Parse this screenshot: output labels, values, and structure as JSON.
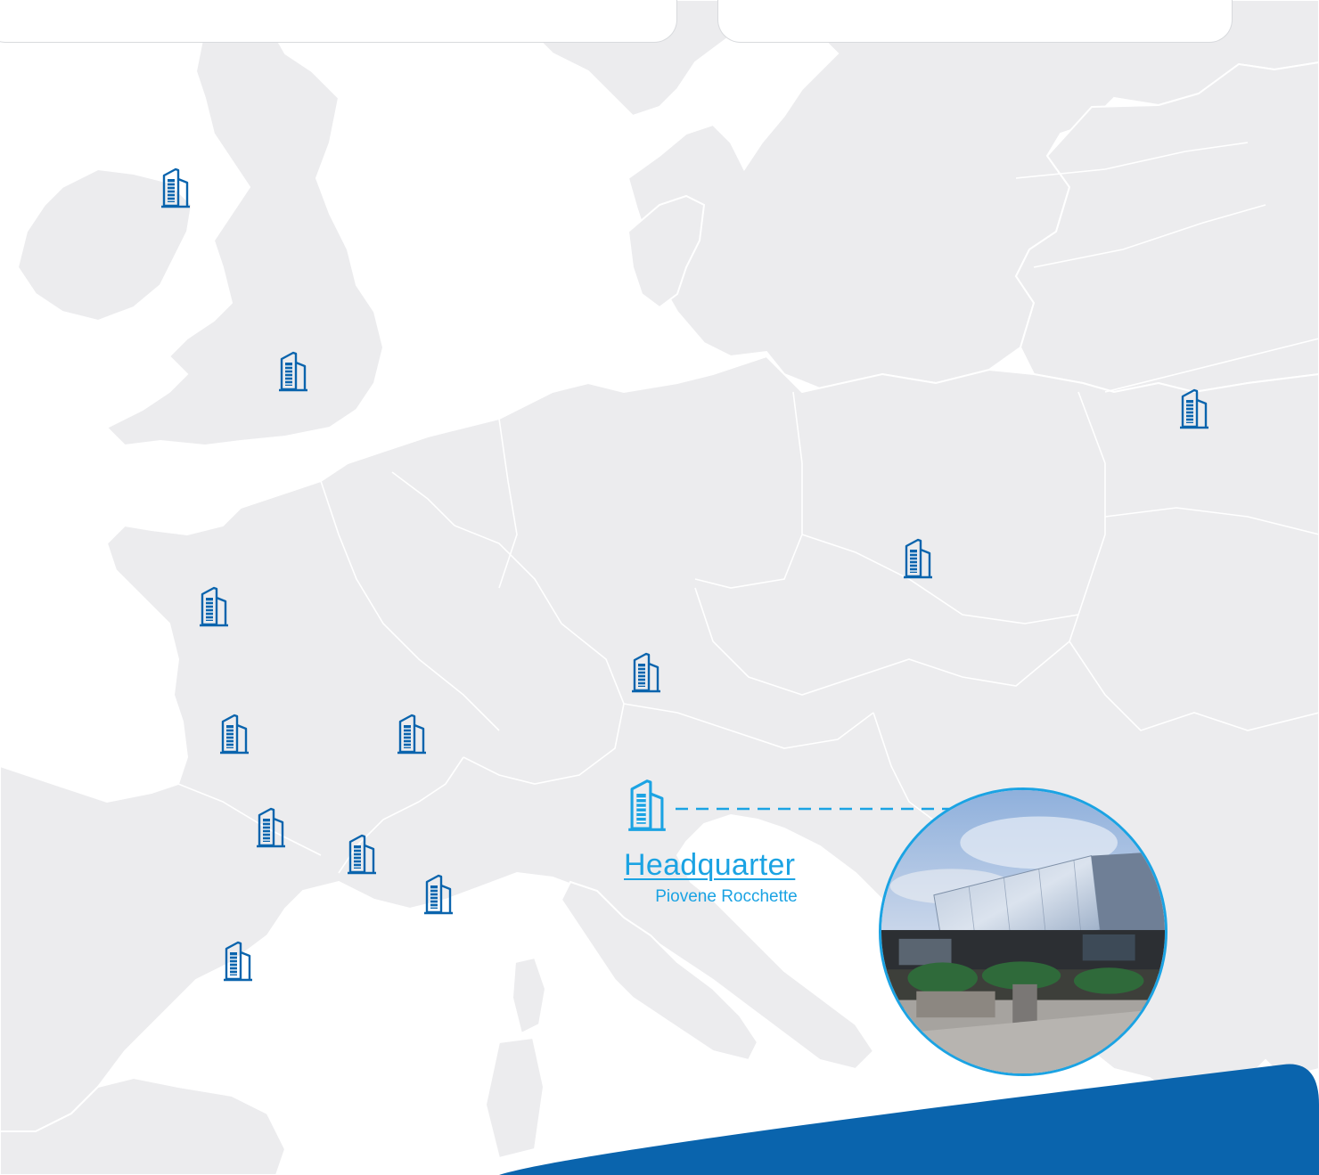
{
  "colors": {
    "map_land": "#ececee",
    "map_border": "#ffffff",
    "sea": "#ffffff",
    "office_marker": "#0a64ad",
    "headquarter": "#1ba3e3",
    "footer_band": "#0a64ad"
  },
  "icons": {
    "office_marker": "office-building-icon",
    "headquarter_marker": "office-building-icon"
  },
  "offices": [
    {
      "id": "office-northern-ireland"
    },
    {
      "id": "office-england"
    },
    {
      "id": "office-latvia"
    },
    {
      "id": "office-poland"
    },
    {
      "id": "office-brittany"
    },
    {
      "id": "office-bavaria"
    },
    {
      "id": "office-bordeaux"
    },
    {
      "id": "office-lyon"
    },
    {
      "id": "office-toulouse"
    },
    {
      "id": "office-provence"
    },
    {
      "id": "office-cote-azur"
    },
    {
      "id": "office-perpignan"
    }
  ],
  "headquarter": {
    "label": "Headquarter",
    "city": "Piovene Rocchette",
    "photo": "headquarter-building-photo"
  }
}
